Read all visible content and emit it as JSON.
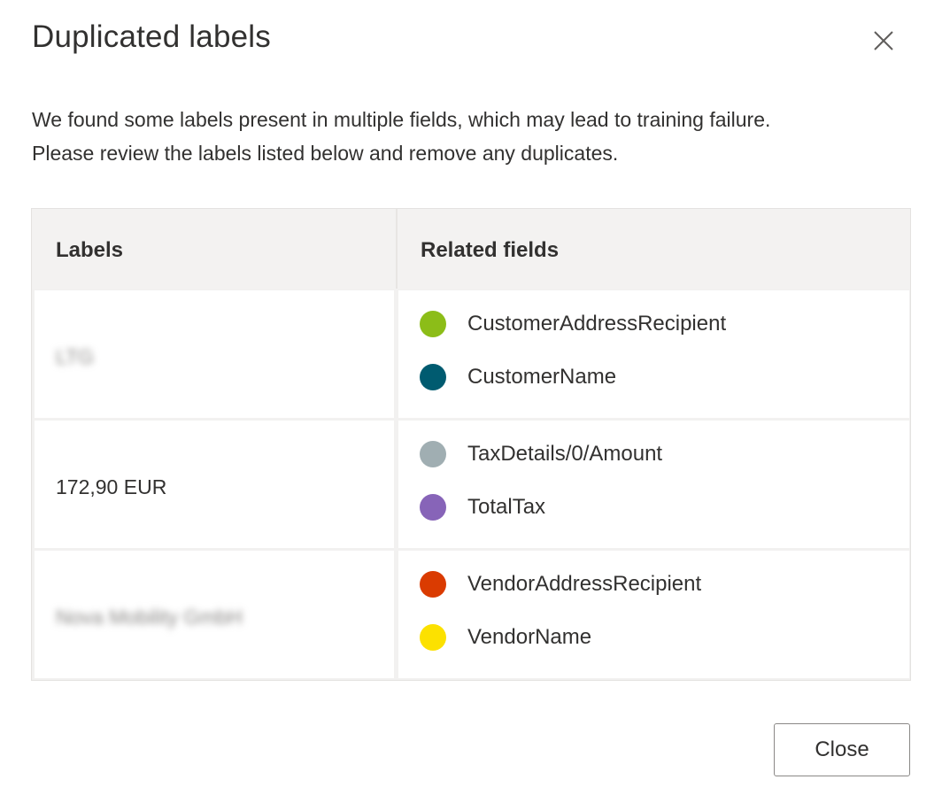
{
  "dialog": {
    "title": "Duplicated labels",
    "description_line1": "We found some labels present in multiple fields, which may lead to training failure.",
    "description_line2": "Please review the labels listed below and remove any duplicates.",
    "close_label": "Close",
    "close_icon": "close-icon"
  },
  "table": {
    "headers": {
      "labels": "Labels",
      "related_fields": "Related fields"
    },
    "rows": [
      {
        "label": "LTG",
        "label_blurred": true,
        "fields": [
          {
            "name": "CustomerAddressRecipient",
            "color": "#8cbd18"
          },
          {
            "name": "CustomerName",
            "color": "#005b70"
          }
        ]
      },
      {
        "label": "172,90 EUR",
        "label_blurred": false,
        "fields": [
          {
            "name": "TaxDetails/0/Amount",
            "color": "#a0aeb2"
          },
          {
            "name": "TotalTax",
            "color": "#8764b8"
          }
        ]
      },
      {
        "label": "Nova Mobility GmbH",
        "label_blurred": true,
        "fields": [
          {
            "name": "VendorAddressRecipient",
            "color": "#da3b01"
          },
          {
            "name": "VendorName",
            "color": "#fce100"
          }
        ]
      }
    ]
  }
}
